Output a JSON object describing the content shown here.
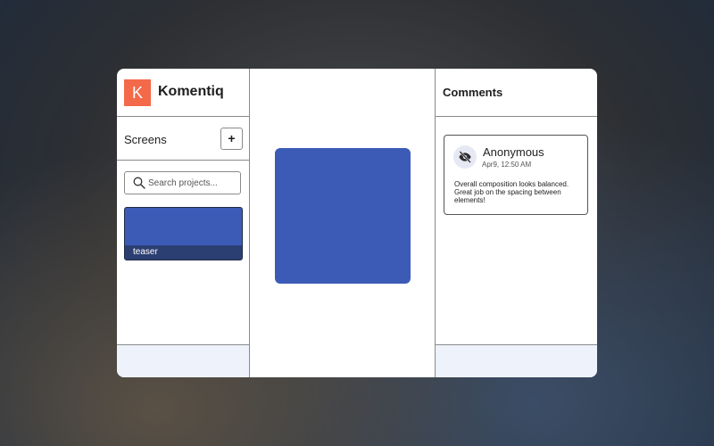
{
  "app": {
    "logo_letter": "K",
    "name": "Komentiq",
    "logo_color": "#f4694a"
  },
  "sidebar": {
    "title": "Screens",
    "add_label": "+",
    "search": {
      "placeholder": "Search projects...",
      "value": ""
    },
    "screens": [
      {
        "label": "teaser",
        "thumbnail_color": "#3b5bb7"
      }
    ]
  },
  "canvas": {
    "shape_color": "#3b5bb7"
  },
  "comments": {
    "title": "Comments",
    "items": [
      {
        "author": "Anonymous",
        "timestamp": "Apr9, 12:50 AM",
        "avatar_icon": "eye-off-icon",
        "text": "Overall composition looks balanced. Great job on the spacing between elements!"
      }
    ]
  }
}
